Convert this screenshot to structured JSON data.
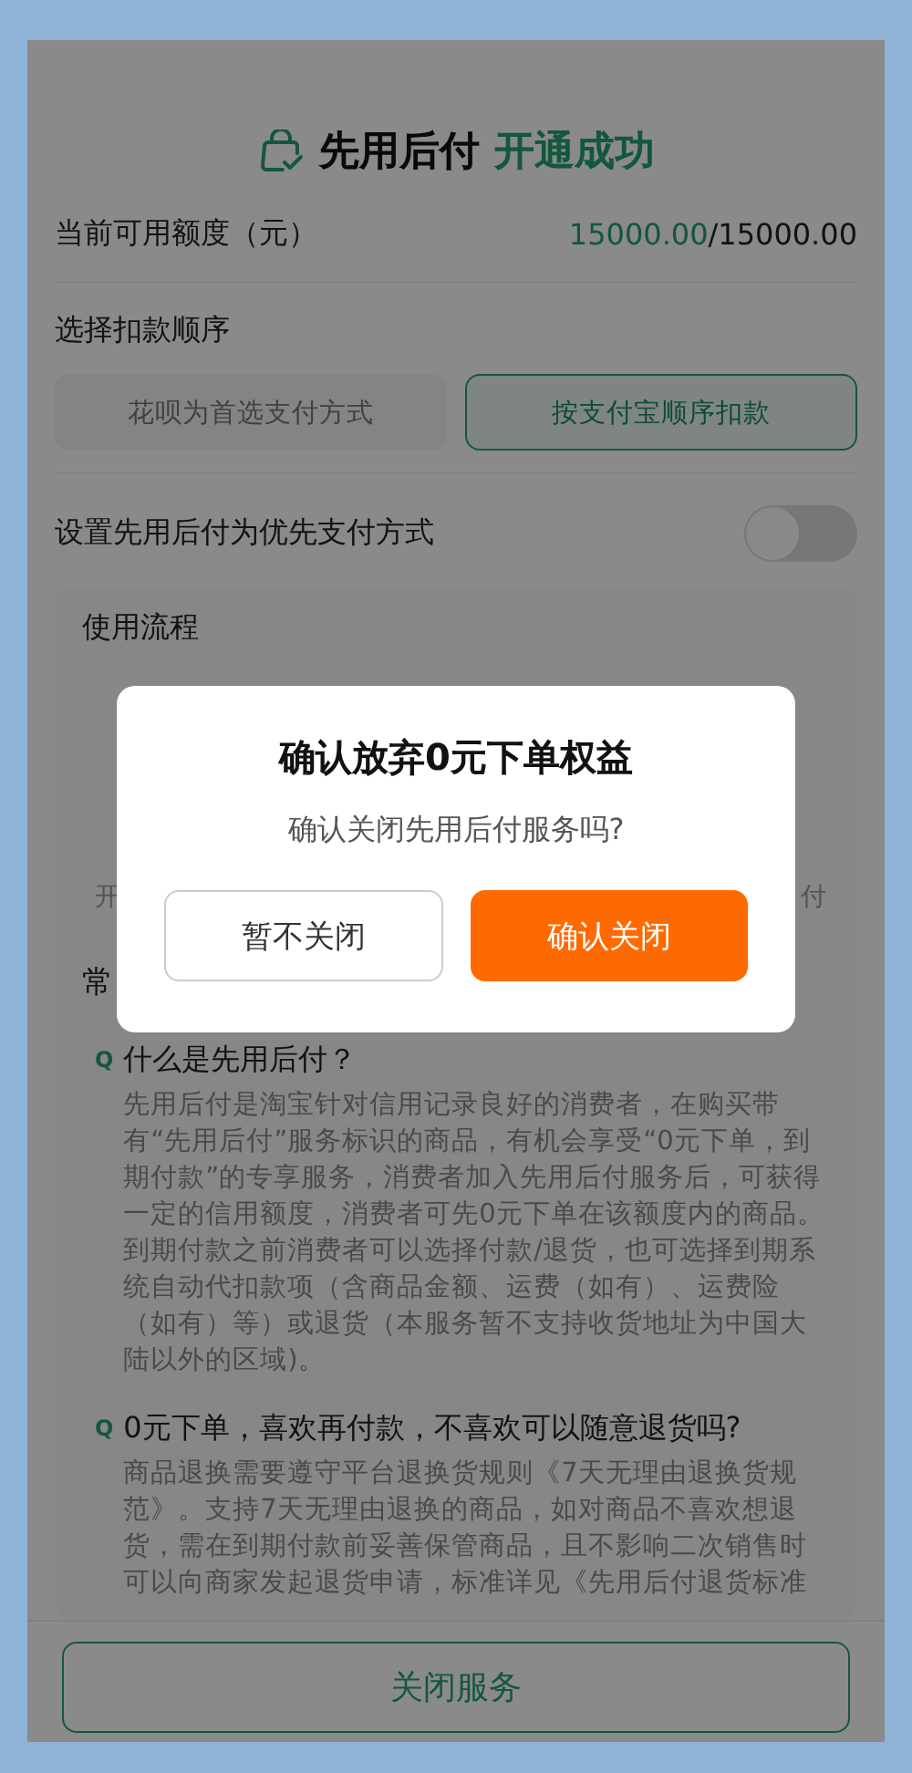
{
  "header": {
    "title": "先用后付",
    "status": "开通成功"
  },
  "credit": {
    "label": "当前可用额度（元）",
    "available": "15000.00",
    "total": "/15000.00"
  },
  "deduction_order": {
    "label": "选择扣款顺序",
    "options": [
      {
        "label": "花呗为首选支付方式",
        "selected": false
      },
      {
        "label": "按支付宝顺序扣款",
        "selected": true
      }
    ]
  },
  "preferred_toggle": {
    "label": "设置先用后付为优先支付方式",
    "on": false
  },
  "usage_flow": {
    "title": "使用流程",
    "step_fragments": [
      "开",
      "付"
    ]
  },
  "faq": {
    "heading_fragment": "常",
    "items": [
      {
        "icon": "Q",
        "question": "什么是先用后付？",
        "answer": "先用后付是淘宝针对信用记录良好的消费者，在购买带有“先用后付”服务标识的商品，有机会享受“0元下单，到期付款”的专享服务，消费者加入先用后付服务后，可获得一定的信用额度，消费者可先0元下单在该额度内的商品。到期付款之前消费者可以选择付款/退货，也可选择到期系统自动代扣款项（含商品金额、运费（如有）、运费险（如有）等）或退货（本服务暂不支持收货地址为中国大陆以外的区域)。"
      },
      {
        "icon": "Q",
        "question": "0元下单，喜欢再付款，不喜欢可以随意退货吗?",
        "answer": "商品退换需要遵守平台退换货规则《7天无理由退换货规范》。支持7天无理由退换的商品，如对商品不喜欢想退货，需在到期付款前妥善保管商品，且不影响二次销售时可以向商家发起退货申请，标准详见《先用后付退货标准"
      }
    ]
  },
  "bottom_button": "关闭服务",
  "dialog": {
    "title": "确认放弃0元下单权益",
    "message": "确认关闭先用后付服务吗?",
    "buttons": [
      {
        "label": "暂不关闭",
        "kind": "secondary"
      },
      {
        "label": "确认关闭",
        "kind": "primary"
      }
    ]
  }
}
